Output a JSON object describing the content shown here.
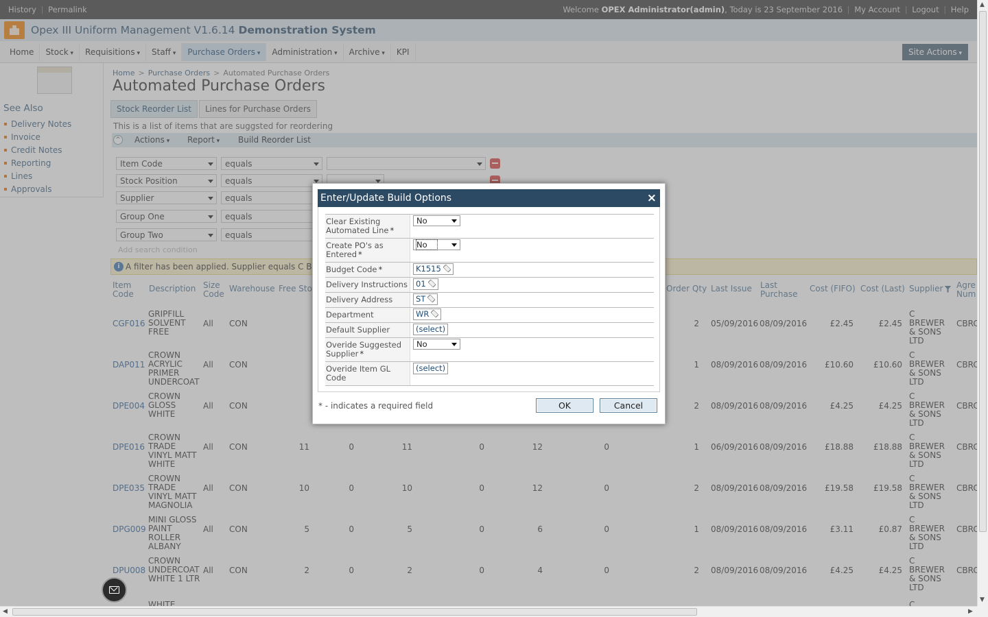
{
  "topbar": {
    "links": [
      "History",
      "Permalink"
    ],
    "welcome_prefix": "Welcome",
    "user": "OPEX Administrator(admin)",
    "date_text": ", Today is 23 September 2016",
    "right_links": [
      "My Account",
      "Logout",
      "Help"
    ]
  },
  "app": {
    "title_main": "Opex III Uniform Management V1.6.14",
    "title_bold": "Demonstration System"
  },
  "nav": {
    "items": [
      "Home",
      "Stock",
      "Requisitions",
      "Staff",
      "Purchase Orders",
      "Administration",
      "Archive",
      "KPI"
    ],
    "site_actions": "Site Actions"
  },
  "sidebar": {
    "see_also": "See Also",
    "links": [
      "Delivery Notes",
      "Invoice",
      "Credit Notes",
      "Reporting",
      "Lines",
      "Approvals"
    ]
  },
  "breadcrumb": [
    "Home",
    "Purchase Orders",
    "Automated Purchase Orders"
  ],
  "page": {
    "title": "Automated Purchase Orders",
    "tabs": [
      "Stock Reorder List",
      "Lines for Purchase Orders"
    ],
    "description": "This is a list of items that are suggsted for reordering",
    "toolbar": [
      "Actions",
      "Report",
      "Build Reorder List"
    ]
  },
  "filters": [
    {
      "field": "Item Code",
      "op": "equals",
      "value": ""
    },
    {
      "field": "Stock Position",
      "op": "equals",
      "value": ""
    },
    {
      "field": "Supplier",
      "op": "equals",
      "value": ""
    },
    {
      "field": "Group One",
      "op": "equals",
      "value": ""
    },
    {
      "field": "Group Two",
      "op": "equals",
      "value": ""
    }
  ],
  "add_condition": "Add search condition",
  "filter_message": "A filter has been applied. Supplier equals C BRE",
  "grid": {
    "headers_left": [
      "Item Code",
      "Description",
      "Size Code",
      "Warehouse",
      "Free Sto"
    ],
    "headers_right": [
      "Order Qty",
      "Last Issue",
      "Last Purchase",
      "Cost (FIFO)",
      "Cost (Last)",
      "Supplier",
      "Agre Num"
    ],
    "rows": [
      {
        "code": "CGF016",
        "desc": "GRIPFILL SOLVENT FREE",
        "size": "All",
        "wh": "CON",
        "n1": "",
        "n2": "",
        "n3": "",
        "n4": "",
        "n5": "",
        "n6": "",
        "qty": "2",
        "last_issue": "05/09/2016",
        "last_purchase": "08/09/2016",
        "fifo": "£2.45",
        "last": "£2.45",
        "supplier": "C BREWER & SONS LTD",
        "agre": "CBRC"
      },
      {
        "code": "DAP011",
        "desc": "CROWN ACRYLIC PRIMER UNDERCOAT",
        "size": "All",
        "wh": "CON",
        "n1": "",
        "n2": "",
        "n3": "",
        "n4": "",
        "n5": "",
        "n6": "",
        "qty": "1",
        "last_issue": "08/09/2016",
        "last_purchase": "08/09/2016",
        "fifo": "£10.60",
        "last": "£10.60",
        "supplier": "C BREWER & SONS LTD",
        "agre": "CBRC"
      },
      {
        "code": "DPE004",
        "desc": "CROWN GLOSS WHITE",
        "size": "All",
        "wh": "CON",
        "n1": "",
        "n2": "",
        "n3": "",
        "n4": "",
        "n5": "",
        "n6": "",
        "qty": "2",
        "last_issue": "08/09/2016",
        "last_purchase": "08/09/2016",
        "fifo": "£4.25",
        "last": "£4.25",
        "supplier": "C BREWER & SONS LTD",
        "agre": "CBRC"
      },
      {
        "code": "DPE016",
        "desc": "CROWN TRADE VINYL MATT WHITE",
        "size": "All",
        "wh": "CON",
        "n1": "11",
        "n2": "0",
        "n3": "11",
        "n4": "0",
        "n5": "12",
        "n6": "0",
        "qty": "1",
        "last_issue": "06/09/2016",
        "last_purchase": "08/09/2016",
        "fifo": "£18.88",
        "last": "£18.88",
        "supplier": "C BREWER & SONS LTD",
        "agre": "CBRC"
      },
      {
        "code": "DPE035",
        "desc": "CROWN TRADE VINYL MATT MAGNOLIA",
        "size": "All",
        "wh": "CON",
        "n1": "10",
        "n2": "0",
        "n3": "10",
        "n4": "0",
        "n5": "12",
        "n6": "0",
        "qty": "2",
        "last_issue": "08/09/2016",
        "last_purchase": "08/09/2016",
        "fifo": "£19.58",
        "last": "£19.58",
        "supplier": "C BREWER & SONS LTD",
        "agre": "CBRC"
      },
      {
        "code": "DPG009",
        "desc": "MINI GLOSS PAINT ROLLER ALBANY",
        "size": "All",
        "wh": "CON",
        "n1": "5",
        "n2": "0",
        "n3": "5",
        "n4": "0",
        "n5": "6",
        "n6": "0",
        "qty": "1",
        "last_issue": "08/09/2016",
        "last_purchase": "08/09/2016",
        "fifo": "£3.11",
        "last": "£0.87",
        "supplier": "C BREWER & SONS LTD",
        "agre": "CBRC"
      },
      {
        "code": "DPU008",
        "desc": "CROWN UNDERCOAT WHITE 1 LTR",
        "size": "All",
        "wh": "CON",
        "n1": "2",
        "n2": "0",
        "n3": "2",
        "n4": "0",
        "n5": "4",
        "n6": "0",
        "qty": "2",
        "last_issue": "08/09/2016",
        "last_purchase": "08/09/2016",
        "fifo": "£4.25",
        "last": "£4.25",
        "supplier": "C BREWER & SONS LTD",
        "agre": "CBRC"
      },
      {
        "code": "",
        "desc": "WHITE",
        "size": "",
        "wh": "",
        "n1": "",
        "n2": "",
        "n3": "",
        "n4": "",
        "n5": "",
        "n6": "",
        "qty": "",
        "last_issue": "",
        "last_purchase": "",
        "fifo": "",
        "last": "",
        "supplier": "C BREWER",
        "agre": ""
      }
    ]
  },
  "dialog": {
    "title": "Enter/Update Build Options",
    "close": "×",
    "fields": [
      {
        "label": "Clear Existing Automated Line",
        "required": true,
        "type": "select",
        "value": "No"
      },
      {
        "label": "Create PO's as Entered",
        "required": true,
        "type": "select",
        "value": "No"
      },
      {
        "label": "Budget Code",
        "required": true,
        "type": "picker",
        "value": "K1515"
      },
      {
        "label": "Delivery Instructions",
        "required": false,
        "type": "picker",
        "value": "01"
      },
      {
        "label": "Delivery Address",
        "required": false,
        "type": "picker",
        "value": "ST"
      },
      {
        "label": "Department",
        "required": false,
        "type": "picker",
        "value": "WR"
      },
      {
        "label": "Default Supplier",
        "required": false,
        "type": "link",
        "value": "(select)"
      },
      {
        "label": "Overide Suggested Supplier",
        "required": true,
        "type": "select",
        "value": "No"
      },
      {
        "label": "Overide Item GL Code",
        "required": false,
        "type": "link",
        "value": "(select)"
      }
    ],
    "required_asterisk": "*",
    "required_note": "* - indicates a required field",
    "ok": "OK",
    "cancel": "Cancel"
  },
  "icons": [
    "logo-icon",
    "site-icon",
    "info-icon",
    "filter-icon",
    "pencil-icon",
    "envelope-icon",
    "close-icon"
  ]
}
